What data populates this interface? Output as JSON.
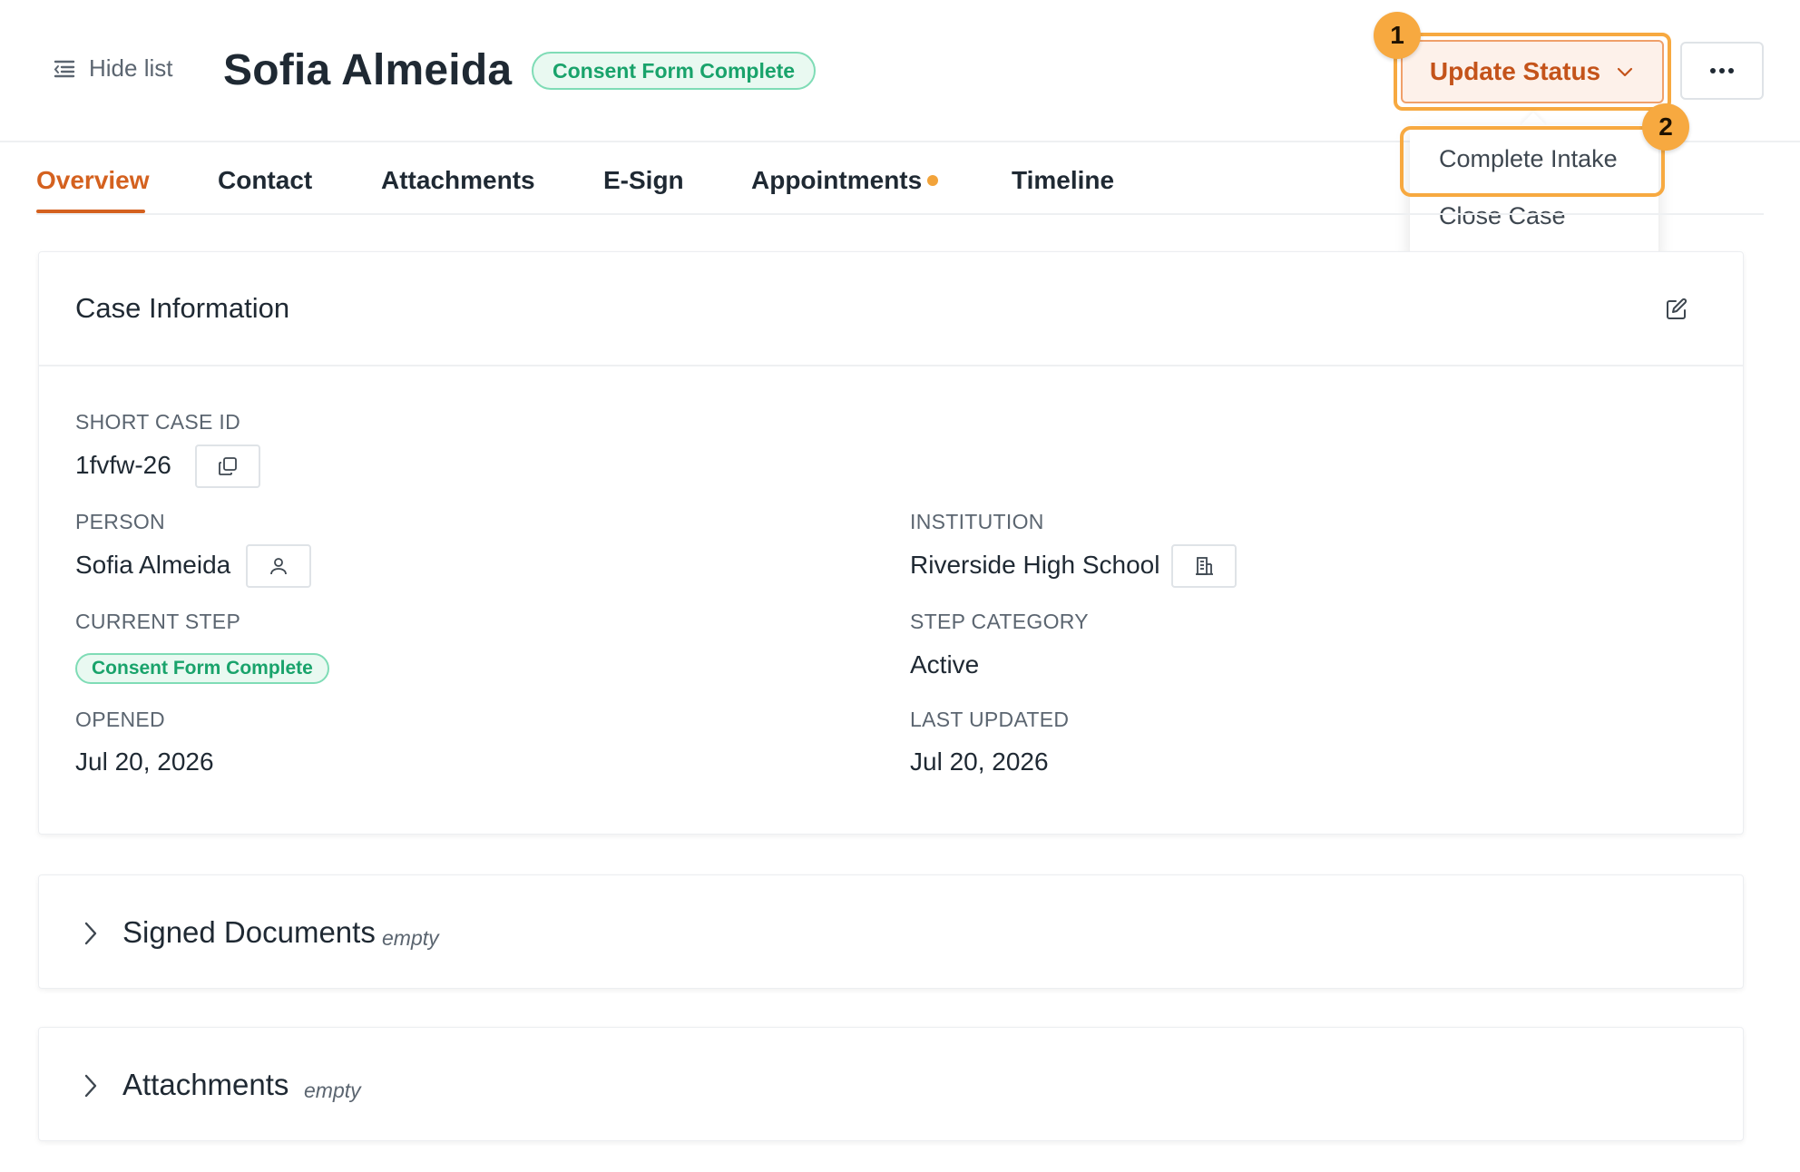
{
  "header": {
    "hide_list_label": "Hide list",
    "title": "Sofia Almeida",
    "status_pill": "Consent Form Complete",
    "update_status_label": "Update Status"
  },
  "annotations": {
    "badge_1": "1",
    "badge_2": "2",
    "highlight_color": "#f7a940"
  },
  "dropdown": {
    "items": [
      {
        "label": "Complete Intake"
      },
      {
        "label": "Close Case"
      }
    ]
  },
  "tabs": [
    {
      "label": "Overview",
      "active": true
    },
    {
      "label": "Contact"
    },
    {
      "label": "Attachments"
    },
    {
      "label": "E-Sign"
    },
    {
      "label": "Appointments",
      "has_dot": true
    },
    {
      "label": "Timeline"
    }
  ],
  "case_info": {
    "title": "Case Information",
    "short_case_id_label": "SHORT CASE ID",
    "short_case_id": "1fvfw-26",
    "person_label": "PERSON",
    "person": "Sofia Almeida",
    "institution_label": "INSTITUTION",
    "institution": "Riverside High School",
    "current_step_label": "CURRENT STEP",
    "current_step": "Consent Form Complete",
    "step_category_label": "STEP CATEGORY",
    "step_category": "Active",
    "opened_label": "OPENED",
    "opened": "Jul 20, 2026",
    "last_updated_label": "LAST UPDATED",
    "last_updated": "Jul 20, 2026"
  },
  "sections": [
    {
      "title": "Signed Documents",
      "state": "empty"
    },
    {
      "title": "Attachments",
      "state": "empty"
    }
  ],
  "colors": {
    "accent": "#d4611f",
    "success": "#19a36b",
    "tab_dot": "#f2a33a"
  },
  "icons": {
    "hide_list": "list-collapse-icon",
    "update_status": "chevron-down-icon",
    "more": "ellipsis-icon",
    "edit": "edit-icon",
    "copy": "copy-icon",
    "person": "user-icon",
    "institution": "building-icon",
    "expand": "chevron-right-icon"
  }
}
